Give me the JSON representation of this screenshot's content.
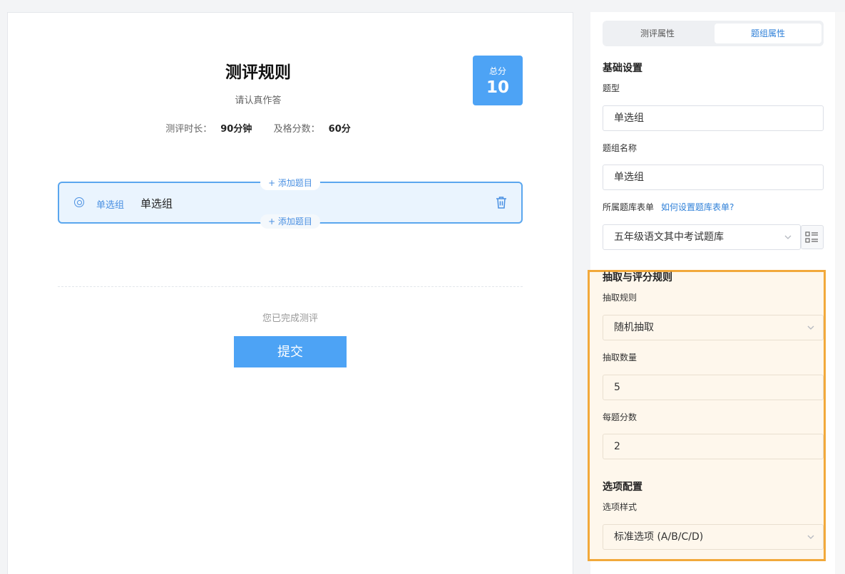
{
  "canvas": {
    "title": "测评规则",
    "subtitle": "请认真作答",
    "duration_label": "测评时长：",
    "duration_value": "90分钟",
    "pass_label": "及格分数：",
    "pass_value": "60分",
    "score_label": "总分",
    "score_value": "10",
    "add_question_label": "+ 添加题目",
    "group": {
      "tag": "单选组",
      "name": "单选组"
    },
    "done_text": "您已完成测评",
    "submit_label": "提交"
  },
  "panel": {
    "tabs": [
      {
        "label": "测评属性",
        "active": false
      },
      {
        "label": "题组属性",
        "active": true
      }
    ],
    "basic": {
      "title": "基础设置",
      "type_label": "题型",
      "type_value": "单选组",
      "name_label": "题组名称",
      "name_value": "单选组",
      "bank_label": "所属题库表单",
      "bank_help_link": "如何设置题库表单?",
      "bank_value": "五年级语文其中考试题库"
    },
    "rules": {
      "title": "抽取与评分规则",
      "draw_rule_label": "抽取规则",
      "draw_rule_value": "随机抽取",
      "draw_count_label": "抽取数量",
      "draw_count_value": "5",
      "score_each_label": "每题分数",
      "score_each_value": "2"
    },
    "options": {
      "title": "选项配置",
      "style_label": "选项样式",
      "style_value": "标准选项 (A/B/C/D)"
    }
  },
  "colors": {
    "accent": "#4da3f5",
    "link": "#2f80d8",
    "highlight_border": "#f2a93b",
    "highlight_bg": "#fef7ec"
  }
}
